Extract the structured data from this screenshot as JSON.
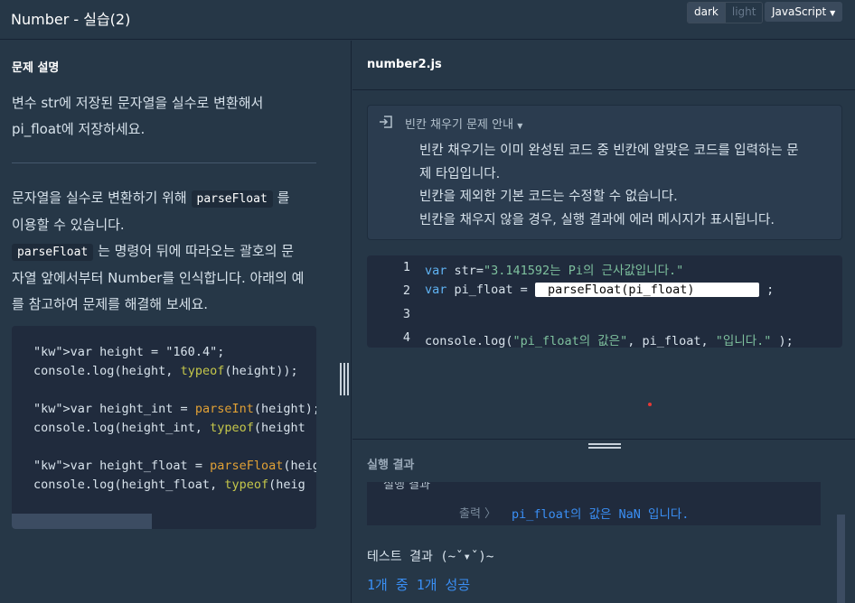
{
  "header": {
    "title": "Number - 실습(2)",
    "theme_dark": "dark",
    "theme_light": "light",
    "language": "JavaScript"
  },
  "left": {
    "section_title": "문제 설명",
    "desc_line1": "변수 str에 저장된 문자열을 실수로 변환해서",
    "desc_line2": "pi_float에 저장하세요.",
    "body": {
      "p1_a": "문자열을 실수로 변환하기 위해",
      "p1_code": "parseFloat",
      "p1_b": "를",
      "p1_c": "이용할 수 있습니다.",
      "p2_code": "parseFloat",
      "p2_a": "는 명령어 뒤에 따라오는 괄호의 문",
      "p2_b": "자열 앞에서부터 Number를 인식합니다. 아래의 예",
      "p2_c": "를 참고하여 문제를 해결해 보세요."
    },
    "example_code": [
      "var height = \"160.4\";",
      "console.log(height, typeof(height));",
      "",
      "var height_int = parseInt(height);",
      "console.log(height_int, typeof(height",
      "",
      "var height_float = parseFloat(height)",
      "console.log(height_float, typeof(heig"
    ]
  },
  "right": {
    "file_name": "number2.js",
    "guide": {
      "title": "빈칸 채우기 문제 안내",
      "line1": "빈칸 채우기는 이미 완성된 코드 중 빈칸에 알맞은 코드를 입력하는 문",
      "line2": "제 타입입니다.",
      "line3": "빈칸을 제외한 기본 코드는 수정할 수 없습니다.",
      "line4": "빈칸을 채우지 않을 경우, 실행 결과에 에러 메시지가 표시됩니다."
    },
    "editor": {
      "line_numbers": [
        "1",
        "2",
        "3",
        "4"
      ],
      "l1_kw": "var",
      "l1_var": " str=",
      "l1_str": "\"3.141592는 Pi의 근사값입니다.\"",
      "l2_kw": "var",
      "l2_var": " pi_float = ",
      "l2_blank": "parseFloat(pi_float)",
      "l2_end": " ;",
      "l4_a": "console.log(",
      "l4_str1": "\"pi_float의 값은\"",
      "l4_b": ", pi_float, ",
      "l4_str2": "\"입니다.\"",
      "l4_c": " );"
    },
    "result": {
      "title": "실행 결과",
      "cut_text": "실행 결과",
      "output_label": "출력 〉",
      "output_value": "pi_float의 값은 NaN 입니다.",
      "test_result": "테스트 결과 (~ˇ▾ˇ)~",
      "pass": "1개 중 1개 성공"
    }
  }
}
